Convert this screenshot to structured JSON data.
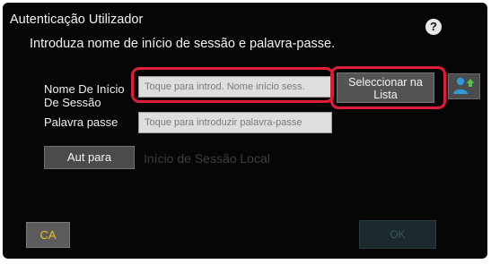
{
  "dialog": {
    "title": "Autenticação Utilizador",
    "help_icon": "?",
    "instruction": "Introduza nome de início de sessão e palavra-passe."
  },
  "form": {
    "username_label": "Nome De Início De Sessão",
    "username_placeholder": "Toque para introd. Nome início sess.",
    "password_label": "Palavra passe",
    "password_placeholder": "Toque para introduzir palavra-passe",
    "select_from_list_label": "Seleccionar na Lista",
    "user_list_icon": "user-list-icon"
  },
  "auth": {
    "auth_button_label": "Aut para",
    "auth_destination": "Início de Sessão Local"
  },
  "footer": {
    "ca_label": "CA",
    "ok_label": "OK"
  },
  "colors": {
    "highlight": "#e11b3c",
    "ca_text": "#e8c21a",
    "user_icon_blue": "#2f9bd8",
    "user_icon_arrow": "#58c04a"
  }
}
